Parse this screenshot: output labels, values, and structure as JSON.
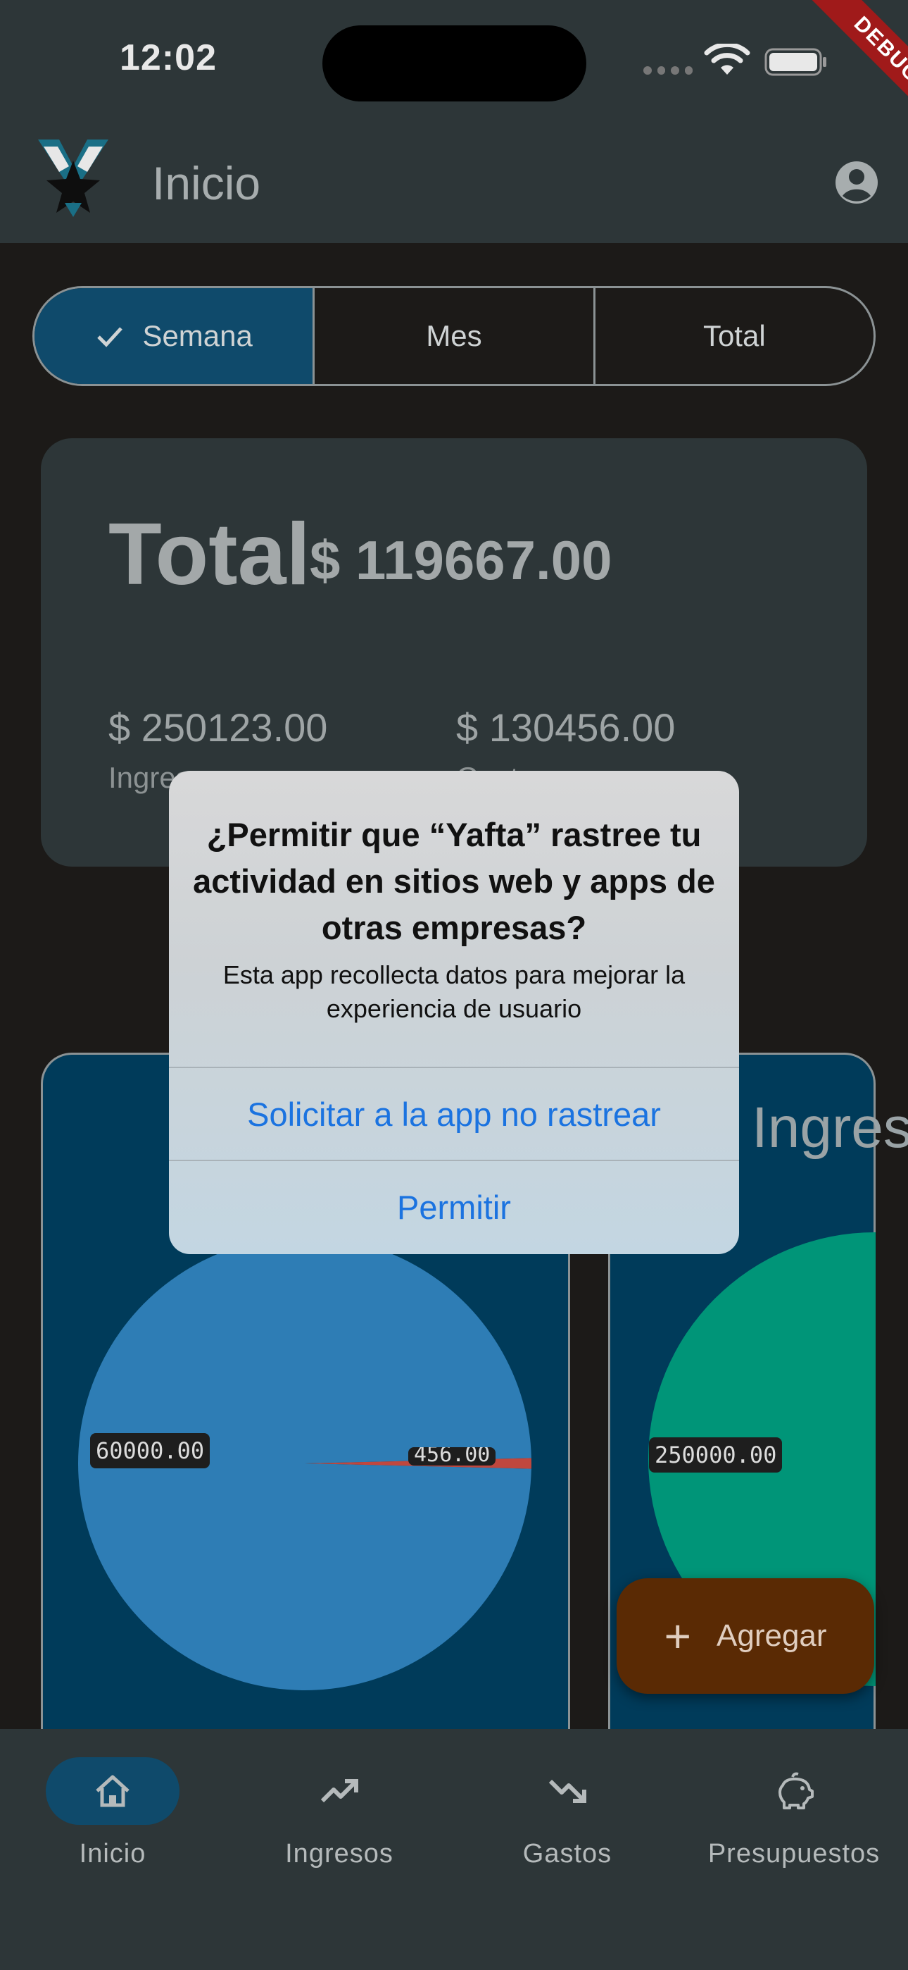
{
  "status_bar": {
    "time": "12:02",
    "debug_banner": "DEBUG"
  },
  "app_bar": {
    "title": "Inicio",
    "logo_icon": "yafta-logo-icon",
    "account_icon": "account-circle-icon"
  },
  "period_selector": {
    "options": [
      {
        "label": "Semana",
        "selected": true
      },
      {
        "label": "Mes",
        "selected": false
      },
      {
        "label": "Total",
        "selected": false
      }
    ]
  },
  "summary": {
    "total_label": "Total",
    "total_amount": "$ 119667.00",
    "income_amount": "$ 250123.00",
    "income_label": "Ingresos",
    "expense_amount": "$ 130456.00",
    "expense_label": "Gastos"
  },
  "charts": {
    "ingresos_title": "Ingresos",
    "gastos_tags": [
      "60000.00",
      "456.00"
    ],
    "ingresos_tags": [
      "250000.00"
    ]
  },
  "chart_data": [
    {
      "type": "pie",
      "values": [
        60000.0,
        456.0
      ],
      "colors": [
        "#2e7db5",
        "#c0473e"
      ]
    },
    {
      "type": "pie",
      "values": [
        250000.0
      ],
      "colors": [
        "#009578"
      ]
    }
  ],
  "fab": {
    "label": "Agregar",
    "icon": "plus-icon",
    "color": "#5a2a04"
  },
  "alert": {
    "title": "¿Permitir que “Yafta” rastree tu actividad en sitios web y apps de otras empresas?",
    "message": "Esta app recollecta datos para mejorar la experiencia de usuario",
    "button_no_track": "Solicitar a la app no rastrear",
    "button_allow": "Permitir"
  },
  "bottom_nav": {
    "items": [
      {
        "label": "Inicio",
        "icon": "home-icon",
        "active": true
      },
      {
        "label": "Ingresos",
        "icon": "trending-up-icon",
        "active": false
      },
      {
        "label": "Gastos",
        "icon": "trending-down-icon",
        "active": false
      },
      {
        "label": "Presupuestos",
        "icon": "piggy-bank-icon",
        "active": false
      }
    ]
  },
  "colors": {
    "accent": "#0f4a6b",
    "surface": "#2d3638",
    "background": "#1c1a18",
    "link": "#1b73e0"
  }
}
